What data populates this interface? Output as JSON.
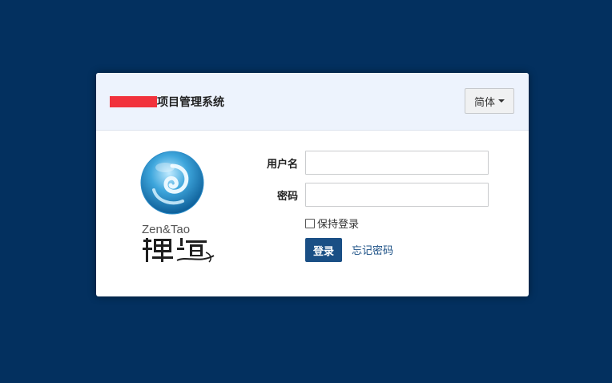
{
  "header": {
    "title": "项目管理系统",
    "language_button": "简体"
  },
  "logo": {
    "brand_text": "Zen&Tao",
    "brand_chinese": "禪道"
  },
  "form": {
    "username_label": "用户名",
    "username_value": "",
    "password_label": "密码",
    "password_value": "",
    "remember_label": "保持登录",
    "remember_checked": false,
    "login_button": "登录",
    "forgot_link": "忘记密码"
  },
  "colors": {
    "background": "#03305f",
    "header_bg": "#edf3fd",
    "primary": "#1a4f85",
    "redaction": "#f1323c"
  }
}
